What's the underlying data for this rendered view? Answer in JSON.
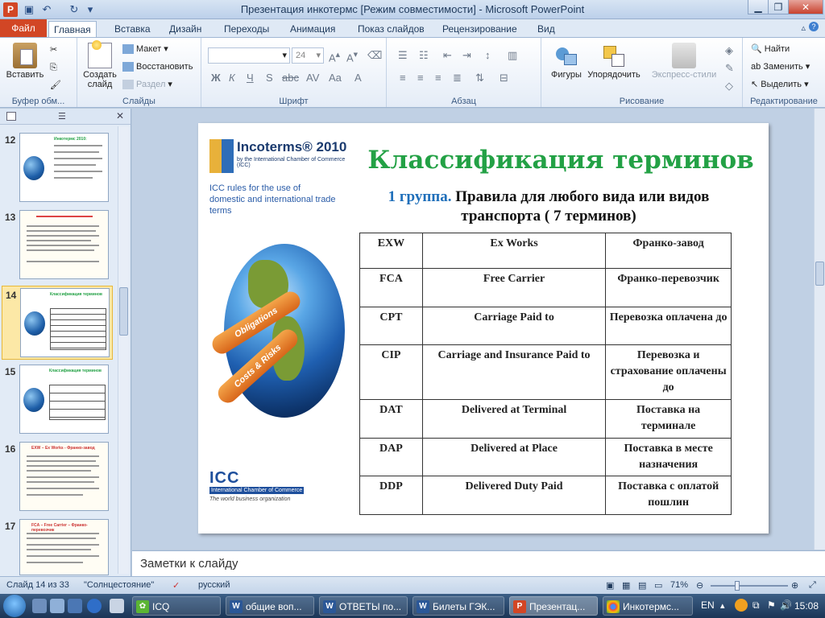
{
  "window": {
    "title": "Презентация инкотермс [Режим совместимости]  -  Microsoft PowerPoint"
  },
  "ribbon_tabs": [
    "Файл",
    "Главная",
    "Вставка",
    "Дизайн",
    "Переходы",
    "Анимация",
    "Показ слайдов",
    "Рецензирование",
    "Вид"
  ],
  "ribbon": {
    "clipboard": {
      "paste": "Вставить",
      "label": "Буфер обм..."
    },
    "slides": {
      "new_slide": "Создать слайд",
      "layout": "Макет",
      "reset": "Восстановить",
      "section": "Раздел",
      "label": "Слайды"
    },
    "font": {
      "size": "24",
      "label": "Шрифт"
    },
    "paragraph": {
      "label": "Абзац"
    },
    "drawing": {
      "shapes": "Фигуры",
      "arrange": "Упорядочить",
      "quick_styles": "Экспресс-стили",
      "label": "Рисование"
    },
    "editing": {
      "find": "Найти",
      "replace": "Заменить",
      "select": "Выделить",
      "label": "Редактирование"
    }
  },
  "thumbnails": [
    {
      "num": "12",
      "title": "Инкотермс 2010:"
    },
    {
      "num": "13",
      "title": ""
    },
    {
      "num": "14",
      "title": "Классификация терминов"
    },
    {
      "num": "15",
      "title": "Классификация терминов"
    },
    {
      "num": "16",
      "title": "EXW – Ex Works - Франко-завод"
    },
    {
      "num": "17",
      "title": "FCA – Free Carrier – Франко-перевозчик"
    }
  ],
  "slide": {
    "logo_text": "Incoterms® 2010",
    "logo_sub": "by the International Chamber of Commerce (ICC)",
    "rules_text": "ICC rules for the use of domestic and international trade terms",
    "arrow1": "Obligations",
    "arrow2": "Costs & Risks",
    "icc_name": "International Chamber of Commerce",
    "icc_tag": "The world business organization",
    "title": "Классификация терминов",
    "sub_group": "1 группа.",
    "sub_rest": "Правила для любого вида или видов транспорта ( 7 терминов)",
    "table": [
      [
        "EXW",
        "Ex Works",
        "Франко-завод"
      ],
      [
        "FCA",
        "Free Carrier",
        "Франко-перевозчик"
      ],
      [
        "CPT",
        "Carriage Paid to",
        "Перевозка оплачена до"
      ],
      [
        "CIP",
        "Carriage and Insurance Paid to",
        "Перевозка и страхование оплачены до"
      ],
      [
        "DAT",
        "Delivered at Terminal",
        "Поставка на терминале"
      ],
      [
        "DAP",
        "Delivered at Place",
        "Поставка в месте назначения"
      ],
      [
        "DDP",
        "Delivered Duty Paid",
        "Поставка с оплатой пошлин"
      ]
    ]
  },
  "notes_placeholder": "Заметки к слайду",
  "status": {
    "slide": "Слайд 14 из 33",
    "theme": "\"Солнцестояние\"",
    "lang": "русский",
    "zoom": "71%"
  },
  "taskbar": {
    "items": [
      "ICQ",
      "общие воп...",
      "ОТВЕТЫ по...",
      "Билеты ГЭК...",
      "Презентац...",
      "Инкотермс..."
    ],
    "lang": "EN",
    "time": "15:08"
  },
  "colors": {
    "title_green": "#23a145",
    "group_blue": "#1f6fba",
    "file_tab": "#d24625"
  }
}
